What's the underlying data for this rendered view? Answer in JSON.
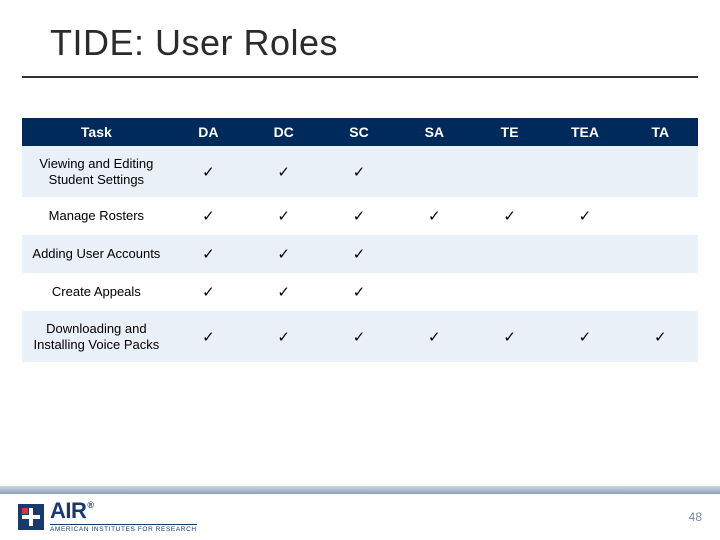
{
  "title": "TIDE: User Roles",
  "columns": [
    "Task",
    "DA",
    "DC",
    "SC",
    "SA",
    "TE",
    "TEA",
    "TA"
  ],
  "check_glyph": "✓",
  "rows": [
    {
      "task": "Viewing and Editing Student Settings",
      "marks": [
        true,
        true,
        true,
        false,
        false,
        false,
        false
      ]
    },
    {
      "task": "Manage Rosters",
      "marks": [
        true,
        true,
        true,
        true,
        true,
        true,
        false
      ]
    },
    {
      "task": "Adding User Accounts",
      "marks": [
        true,
        true,
        true,
        false,
        false,
        false,
        false
      ]
    },
    {
      "task": "Create Appeals",
      "marks": [
        true,
        true,
        true,
        false,
        false,
        false,
        false
      ]
    },
    {
      "task": "Downloading and Installing Voice Packs",
      "marks": [
        true,
        true,
        true,
        true,
        true,
        true,
        true
      ]
    }
  ],
  "footer": {
    "logo_main": "AIR",
    "logo_reg": "®",
    "logo_sub": "AMERICAN INSTITUTES FOR RESEARCH",
    "page_number": "48"
  }
}
